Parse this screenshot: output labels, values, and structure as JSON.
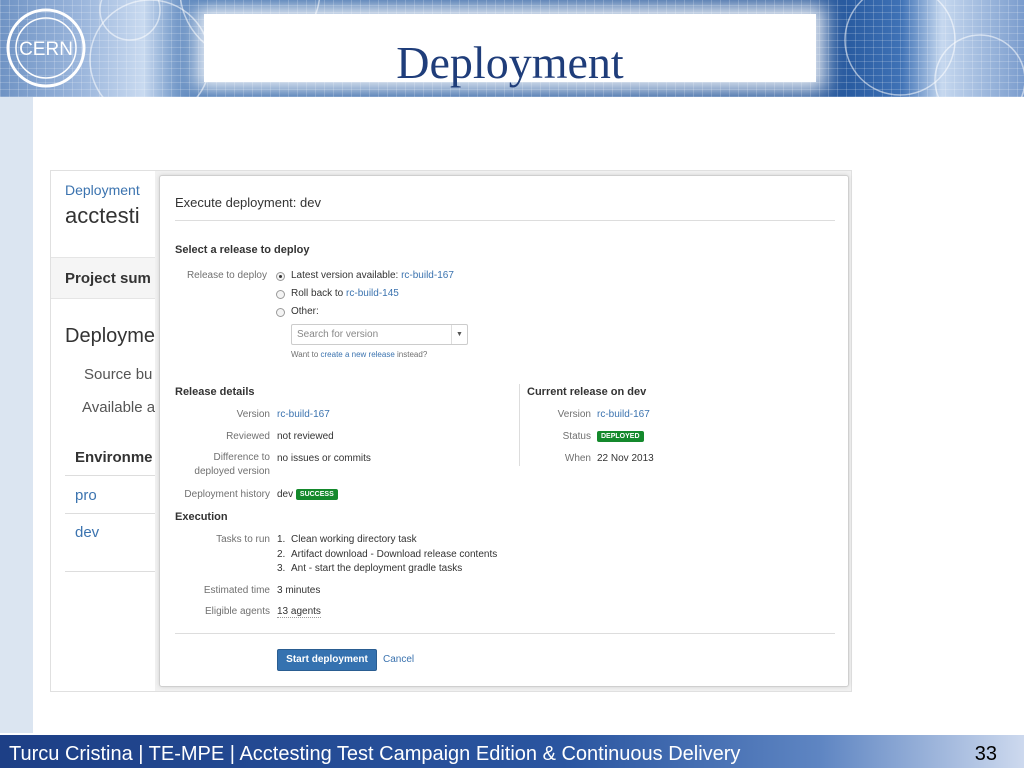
{
  "slide": {
    "title": "Deployment",
    "logo_text": "CERN",
    "footer": "Turcu Cristina | TE-MPE | Acctesting Test Campaign Edition & Continuous Delivery",
    "page_number": "33"
  },
  "background_page": {
    "breadcrumb": "Deployment",
    "plan_name": "acctesti",
    "tab_label": "Project sum",
    "section_heading": "Deployme",
    "source_label": "Source bu",
    "available_label": "Available a",
    "environments_header": "Environme",
    "environments": [
      "pro",
      "dev"
    ]
  },
  "dialog": {
    "title": "Execute deployment: dev",
    "select_section": {
      "heading": "Select a release to deploy",
      "field_label": "Release to deploy",
      "options": [
        {
          "text": "Latest version available:",
          "link": "rc-build-167",
          "checked": true
        },
        {
          "text": "Roll back to",
          "link": "rc-build-145",
          "checked": false
        },
        {
          "text": "Other:",
          "link": "",
          "checked": false
        }
      ],
      "search_placeholder": "Search for version",
      "hint_prefix": "Want to",
      "hint_link": "create a new release",
      "hint_suffix": "instead?"
    },
    "release_details": {
      "heading": "Release details",
      "version_label": "Version",
      "version_value": "rc-build-167",
      "reviewed_label": "Reviewed",
      "reviewed_value": "not reviewed",
      "difference_label": "Difference to deployed version",
      "difference_value": "no issues or commits",
      "history_label": "Deployment history",
      "history_value": "dev",
      "history_badge": "SUCCESS"
    },
    "current_release": {
      "heading": "Current release on dev",
      "version_label": "Version",
      "version_value": "rc-build-167",
      "status_label": "Status",
      "status_badge": "DEPLOYED",
      "when_label": "When",
      "when_value": "22 Nov 2013"
    },
    "execution": {
      "heading": "Execution",
      "tasks_label": "Tasks to run",
      "tasks": [
        {
          "num": "1.",
          "text": "Clean working directory task"
        },
        {
          "num": "2.",
          "text": "Artifact download - Download release contents"
        },
        {
          "num": "3.",
          "text": "Ant - start the deployment gradle tasks"
        }
      ],
      "estimated_label": "Estimated time",
      "estimated_value": "3 minutes",
      "agents_label": "Eligible agents",
      "agents_value": "13 agents"
    },
    "actions": {
      "start_label": "Start deployment",
      "cancel_label": "Cancel"
    }
  },
  "colors": {
    "link": "#3b73af",
    "primary_button": "#3572b0",
    "success": "#14892c",
    "slide_title": "#1f3d7a"
  },
  "icons": {
    "dropdown": "chevron-down-icon",
    "radio": "radio-icon"
  }
}
